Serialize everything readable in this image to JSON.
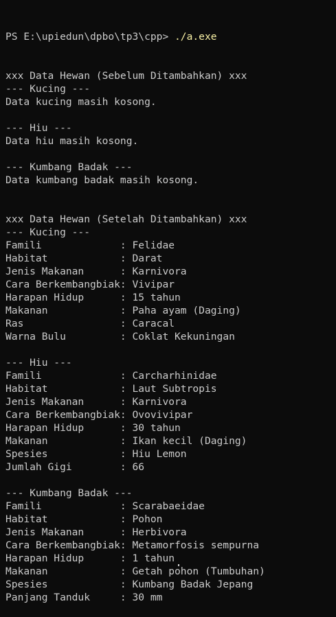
{
  "prompt": {
    "prefix": "PS E:\\upiedun\\dpbo\\tp3\\cpp> ",
    "command": "./a.exe"
  },
  "lines": [
    "xxx Data Hewan (Sebelum Ditambahkan) xxx",
    "--- Kucing ---",
    "Data kucing masih kosong.",
    "",
    "--- Hiu ---",
    "Data hiu masih kosong.",
    "",
    "--- Kumbang Badak ---",
    "Data kumbang badak masih kosong.",
    "",
    "",
    "xxx Data Hewan (Setelah Ditambahkan) xxx",
    "--- Kucing ---",
    "Famili             : Felidae",
    "Habitat            : Darat",
    "Jenis Makanan      : Karnivora",
    "Cara Berkembangbiak: Vivipar",
    "Harapan Hidup      : 15 tahun",
    "Makanan            : Paha ayam (Daging)",
    "Ras                : Caracal",
    "Warna Bulu         : Coklat Kekuningan",
    "",
    "--- Hiu ---",
    "Famili             : Carcharhinidae",
    "Habitat            : Laut Subtropis",
    "Jenis Makanan      : Karnivora",
    "Cara Berkembangbiak: Ovovivipar",
    "Harapan Hidup      : 30 tahun",
    "Makanan            : Ikan kecil (Daging)",
    "Spesies            : Hiu Lemon",
    "Jumlah Gigi        : 66",
    "",
    "--- Kumbang Badak ---",
    "Famili             : Scarabaeidae",
    "Habitat            : Pohon",
    "Jenis Makanan      : Herbivora",
    "Cara Berkembangbiak: Metamorfosis sempurna",
    "Harapan Hidup      : 1 tahun",
    "Makanan            : Getah pohon (Tumbuhan)",
    "Spesies            : Kumbang Badak Jepang",
    "Panjang Tanduk     : 30 mm"
  ],
  "colors": {
    "background": "#0c0c0c",
    "text": "#cccccc",
    "command": "#f9f1a5"
  }
}
